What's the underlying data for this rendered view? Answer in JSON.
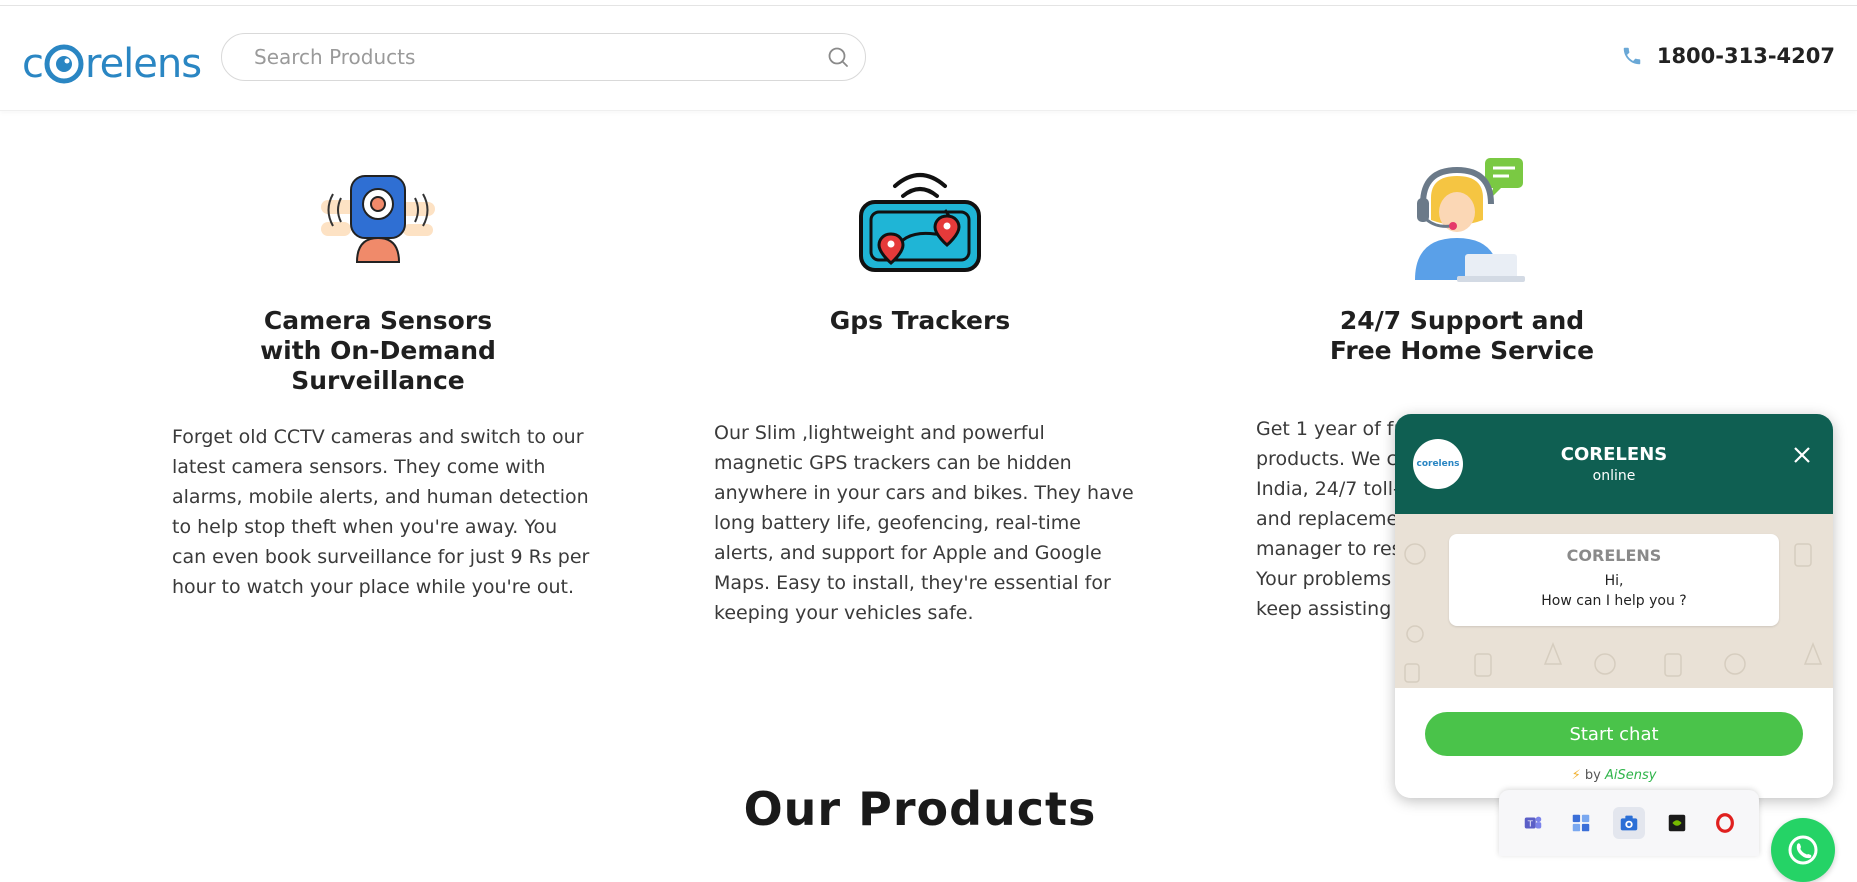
{
  "header": {
    "logo_text_before": "c",
    "logo_text_after": "relens",
    "search_placeholder": "Search Products",
    "phone": "1800-313-4207"
  },
  "features": [
    {
      "title_lines": [
        "Camera Sensors",
        "with On-Demand",
        "Surveillance"
      ],
      "lines": [
        "Forget old CCTV cameras and switch to our",
        "latest camera sensors. They come with",
        "alarms, mobile alerts, and human detection",
        "to help stop theft when you're away. You",
        "can even book surveillance for just 9 Rs per",
        "hour to watch your place while you're out."
      ]
    },
    {
      "title_lines": [
        "Gps Trackers"
      ],
      "lines": [
        "Our Slim ,lightweight and powerful",
        "magnetic GPS trackers can be hidden",
        "anywhere in your cars and bikes. They have",
        "long battery life, geofencing, real-time",
        "alerts, and support for Apple and Google",
        "Maps. Easy to install, they're essential for",
        "keeping your vehicles safe."
      ]
    },
    {
      "title_lines": [
        "24/7 Support and",
        "Free Home Service"
      ],
      "lines": [
        "Get 1 year of fr",
        "products. We c",
        "India, 24/7 toll-",
        "and replaceme",
        "manager to res",
        "Your problems",
        "keep assisting"
      ]
    }
  ],
  "section_title": "Our Products",
  "chat": {
    "avatar_text": "corelens",
    "name": "CORELENS",
    "status": "online",
    "bubble_name": "CORELENS",
    "bubble_line1": "Hi,",
    "bubble_line2": "How can I help you ?",
    "button": "Start chat",
    "powered_prefix": "by",
    "powered_brand": "AiSensy"
  },
  "tray_icons": [
    "teams-icon",
    "widgets-icon",
    "camera-app-icon",
    "nvidia-icon",
    "opera-icon"
  ],
  "colors": {
    "brand_blue": "#2a86c3",
    "chat_header": "#0f5f52",
    "chat_button": "#4ac34a",
    "whatsapp": "#25d366"
  }
}
